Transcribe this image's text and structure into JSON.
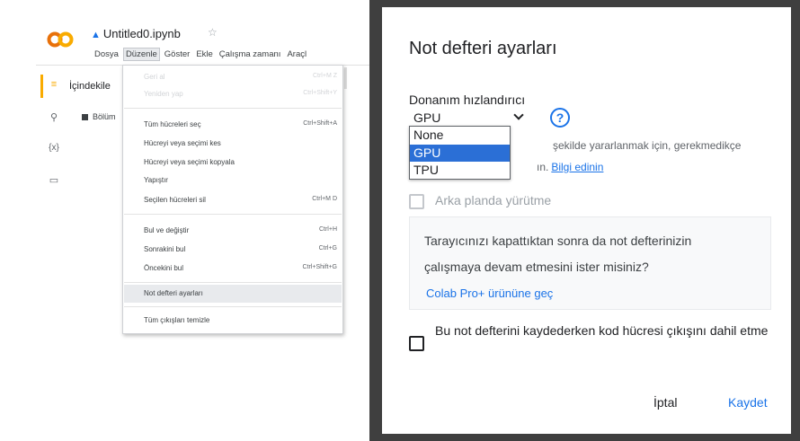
{
  "colab": {
    "logo_text": "CO",
    "file_name": "Untitled0.ipynb",
    "menubar": [
      "Dosya",
      "Düzenle",
      "Göster",
      "Ekle",
      "Çalışma zamanı",
      "Araçl"
    ],
    "sidebar_title": "İçindekile",
    "sidebar_item": "Bölüm",
    "rail_icons": [
      "toc-icon",
      "search-icon",
      "variables-icon",
      "folder-icon"
    ],
    "edit_menu": {
      "items": [
        {
          "label": "Geri al",
          "shortcut": "Ctrl+M Z",
          "disabled": true
        },
        {
          "label": "Yeniden yap",
          "shortcut": "Ctrl+Shift+Y",
          "disabled": true
        },
        {
          "label": "Tüm hücreleri seç",
          "shortcut": "Ctrl+Shift+A",
          "disabled": false
        },
        {
          "label": "Hücreyi veya seçimi kes",
          "shortcut": "",
          "disabled": false
        },
        {
          "label": "Hücreyi veya seçimi kopyala",
          "shortcut": "",
          "disabled": false
        },
        {
          "label": "Yapıştır",
          "shortcut": "",
          "disabled": false
        },
        {
          "label": "Seçilen hücreleri sil",
          "shortcut": "Ctrl+M D",
          "disabled": false
        },
        {
          "label": "Bul ve değiştir",
          "shortcut": "Ctrl+H",
          "disabled": false
        },
        {
          "label": "Sonrakini bul",
          "shortcut": "Ctrl+G",
          "disabled": false
        },
        {
          "label": "Öncekini bul",
          "shortcut": "Ctrl+Shift+G",
          "disabled": false
        },
        {
          "label": "Not defteri ayarları",
          "shortcut": "",
          "disabled": false,
          "highlighted": true
        },
        {
          "label": "Tüm çıkışları temizle",
          "shortcut": "",
          "disabled": false
        }
      ]
    }
  },
  "dialog": {
    "title": "Not defteri ayarları",
    "accelerator_label": "Donanım hızlandırıcı",
    "accelerator_value": "GPU",
    "accelerator_options": [
      "None",
      "GPU",
      "TPU"
    ],
    "selected_option": "GPU",
    "help_symbol": "?",
    "info_line1": "şekilde yararlanmak için, gerekmedikçe",
    "info_line2_prefix": "ın.",
    "info_link": "Bilgi edinin",
    "background_exec_label": "Arka planda yürütme",
    "promo_line1": "Tarayıcınızı kapattıktan sonra da not defterinizin",
    "promo_line2": "çalışmaya devam etmesini ister misiniz?",
    "promo_link": "Colab Pro+ ürününe geç",
    "omit_output_label": "Bu not defterini kaydederken kod hücresi çıkışını dahil etme",
    "cancel_label": "İptal",
    "save_label": "Kaydet"
  },
  "colors": {
    "accent": "#1a73e8",
    "selected_option_bg": "#2b6fd6",
    "logo_orange": "#f9ab00"
  }
}
